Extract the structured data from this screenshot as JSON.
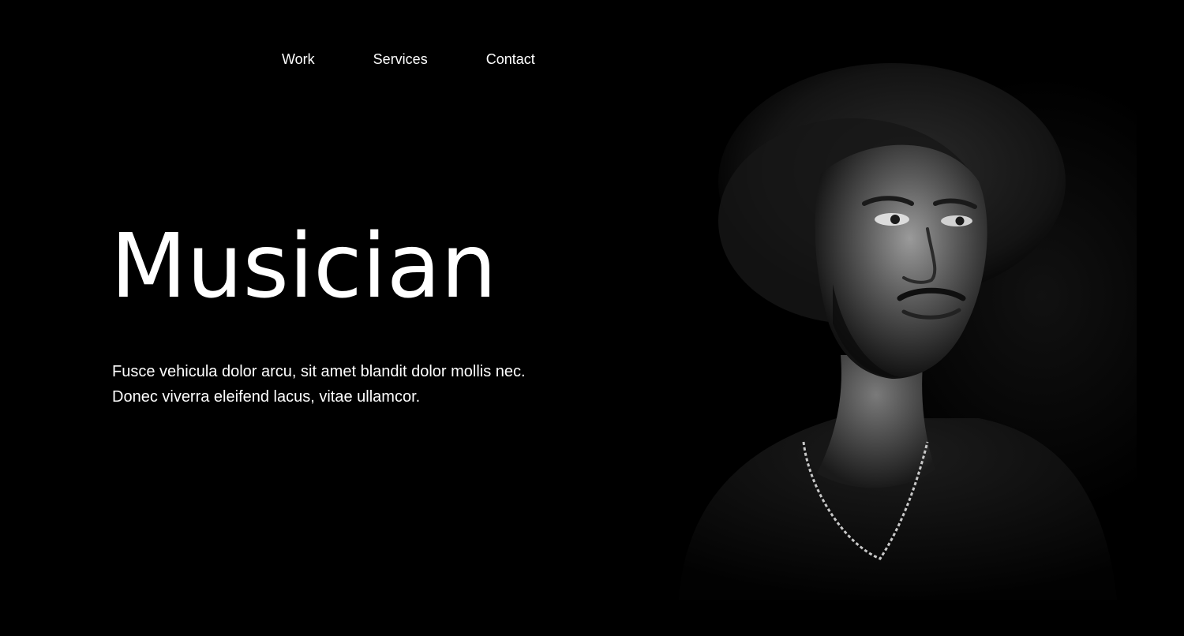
{
  "nav": {
    "items": [
      {
        "label": "Work"
      },
      {
        "label": "Services"
      },
      {
        "label": "Contact"
      }
    ]
  },
  "hero": {
    "title": "Musician",
    "description": "Fusce vehicula dolor arcu, sit amet blandit dolor mollis nec. Donec viverra eleifend lacus, vitae ullamcor."
  },
  "colors": {
    "background": "#000000",
    "text": "#ffffff"
  },
  "image": {
    "subject": "black-and-white portrait photo"
  }
}
